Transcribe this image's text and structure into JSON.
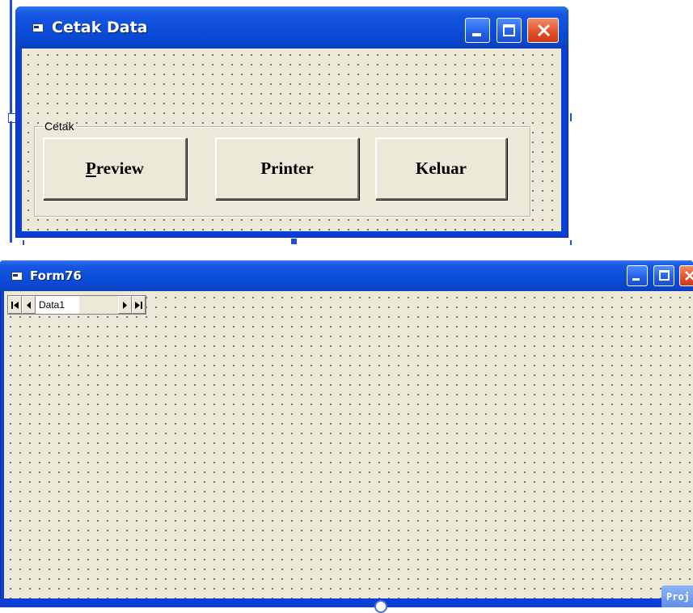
{
  "form1": {
    "title": "Cetak Data",
    "frame_caption": "Cetak",
    "buttons": {
      "preview_prefix": "P",
      "preview_rest": "review",
      "printer": "Printer",
      "keluar": "Keluar"
    }
  },
  "form2": {
    "title": "Form76",
    "data_control_caption": "Data1"
  },
  "project_tab": "Proj",
  "colors": {
    "title_blue": "#0b4ed9",
    "form_face": "#ece9d8",
    "close_red": "#e2532c"
  }
}
